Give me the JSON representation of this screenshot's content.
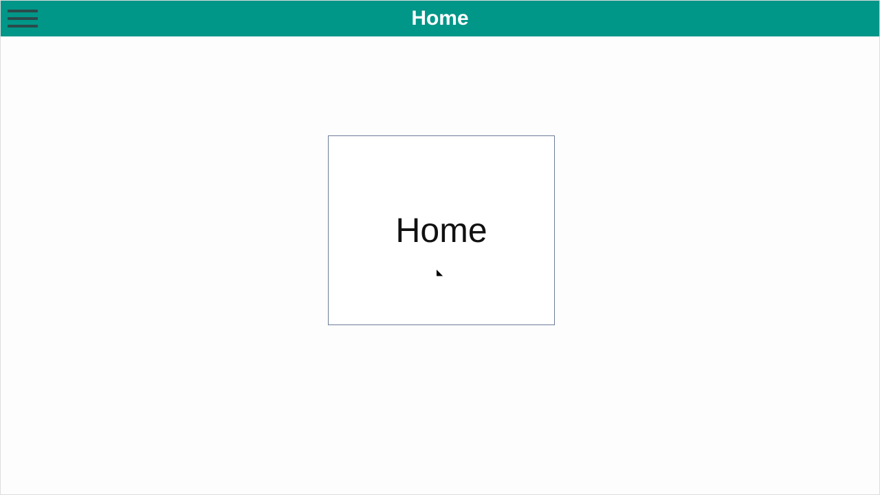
{
  "header": {
    "title": "Home"
  },
  "main": {
    "card_label": "Home"
  },
  "colors": {
    "accent": "#009688",
    "card_border": "#6b7a99"
  }
}
